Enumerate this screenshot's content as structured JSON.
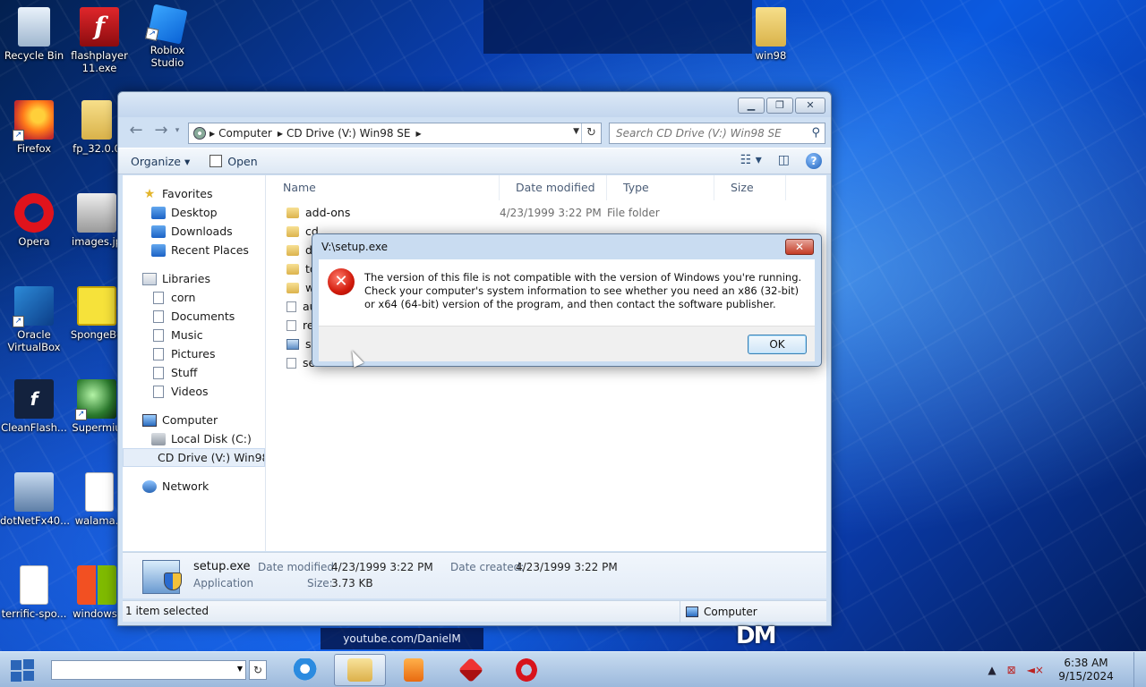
{
  "desktop": {
    "icons": [
      {
        "label": "Recycle Bin",
        "icon": "recycle-bin-icon"
      },
      {
        "label": "flashplayer 11.exe",
        "icon": "flash-player-icon"
      },
      {
        "label": "Roblox Studio",
        "icon": "roblox-studio-icon"
      },
      {
        "label": "win98",
        "icon": "folder-icon"
      },
      {
        "label": "Firefox",
        "icon": "firefox-icon"
      },
      {
        "label": "fp_32.0.0",
        "icon": "folder-zip-icon"
      },
      {
        "label": "Opera",
        "icon": "opera-icon"
      },
      {
        "label": "images.jp",
        "icon": "image-file-icon"
      },
      {
        "label": "Oracle VirtualBox",
        "icon": "virtualbox-icon"
      },
      {
        "label": "SpongeBo",
        "icon": "spongebob-icon"
      },
      {
        "label": "CleanFlash...",
        "icon": "cleanflash-icon"
      },
      {
        "label": "Supermiu",
        "icon": "supermium-icon"
      },
      {
        "label": "dotNetFx40...",
        "icon": "dotnet-installer-icon"
      },
      {
        "label": "walama.s",
        "icon": "document-icon"
      },
      {
        "label": "terrific-spo...",
        "icon": "document-icon"
      },
      {
        "label": "windows-",
        "icon": "windows-logo-icon"
      }
    ],
    "watermark": "youtube.com/DanielM",
    "logo": "DM"
  },
  "explorer": {
    "address": {
      "crumbs": [
        "Computer",
        "CD Drive (V:) Win98 SE"
      ]
    },
    "search_placeholder": "Search CD Drive (V:) Win98 SE",
    "toolbar": {
      "organize": "Organize ▾",
      "open": "Open"
    },
    "nav": {
      "favorites": "Favorites",
      "desktop": "Desktop",
      "downloads": "Downloads",
      "recent": "Recent Places",
      "libraries": "Libraries",
      "corn": "corn",
      "documents": "Documents",
      "music": "Music",
      "pictures": "Pictures",
      "stuff": "Stuff",
      "videos": "Videos",
      "computer": "Computer",
      "local_disk": "Local Disk (C:)",
      "cd_drive": "CD Drive (V:) Win98",
      "network": "Network"
    },
    "columns": {
      "name": "Name",
      "date": "Date modified",
      "type": "Type",
      "size": "Size"
    },
    "rows": [
      {
        "name": "add-ons",
        "date": "4/23/1999 3:22 PM",
        "type": "File folder"
      },
      {
        "name": "cd",
        "date": "",
        "type": ""
      },
      {
        "name": "dr",
        "date": "",
        "type": ""
      },
      {
        "name": "to",
        "date": "",
        "type": ""
      },
      {
        "name": "w",
        "date": "",
        "type": ""
      },
      {
        "name": "au",
        "date": "",
        "type": ""
      },
      {
        "name": "re",
        "date": "",
        "type": ""
      },
      {
        "name": "se",
        "date": "",
        "type": ""
      },
      {
        "name": "se",
        "date": "",
        "type": ""
      }
    ],
    "details": {
      "filename": "setup.exe",
      "filetype": "Application",
      "date_modified_label": "Date modified:",
      "date_modified": "4/23/1999 3:22 PM",
      "size_label": "Size:",
      "size": "3.73 KB",
      "date_created_label": "Date created:",
      "date_created": "4/23/1999 3:22 PM"
    },
    "status": {
      "selection": "1 item selected",
      "zone": "Computer"
    }
  },
  "dialog": {
    "title": "V:\\setup.exe",
    "message": "The version of this file is not compatible with the version of Windows you're running. Check your computer's system information to see whether you need an x86 (32-bit) or x64 (64-bit) version of the program, and then contact the software publisher.",
    "ok": "OK"
  },
  "taskbar": {
    "time": "6:38 AM",
    "date": "9/15/2024",
    "apps": [
      "internet-explorer-icon",
      "file-explorer-icon",
      "media-player-icon",
      "packager-icon",
      "opera-icon"
    ]
  }
}
